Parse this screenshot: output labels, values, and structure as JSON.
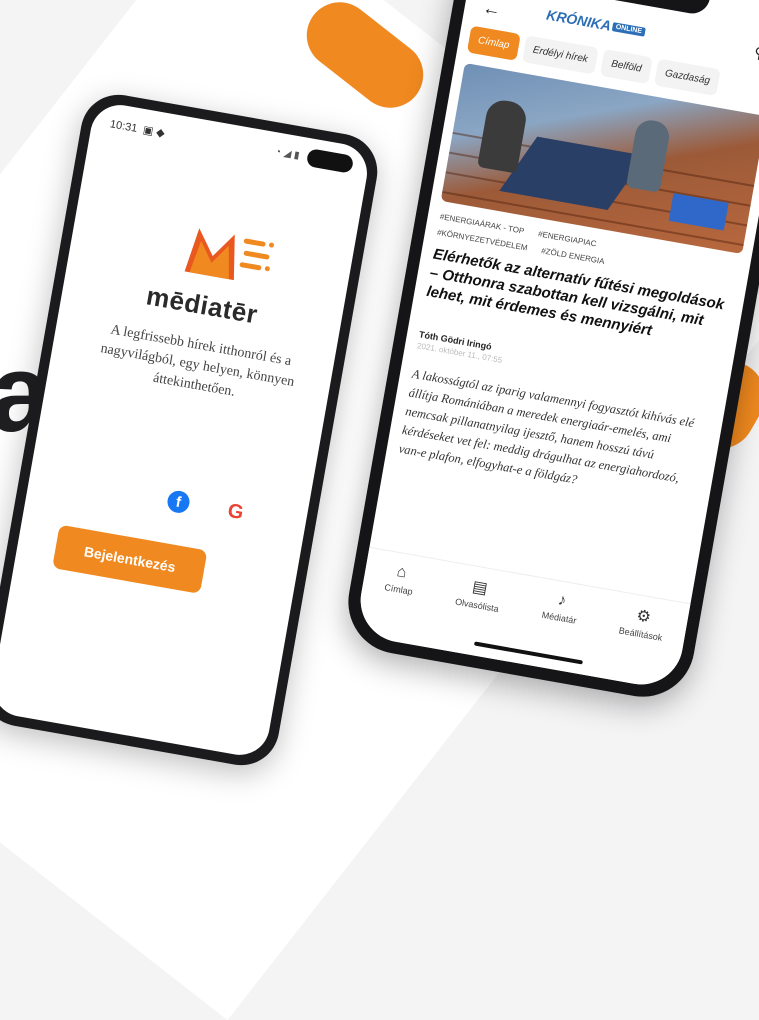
{
  "background_letter": "a",
  "android": {
    "status_time": "10:31",
    "status_icons": "▣ ◆",
    "status_right": "◔ ◢ ▮",
    "logo_text": "mēdiatēr",
    "tagline": "A legfrissebb hírek itthonról és a nagyvilágból, egy helyen, könnyen áttekinthetően.",
    "facebook_glyph": "f",
    "google_glyph": "G",
    "login_label": "Bejelentkezés"
  },
  "app": {
    "back_glyph": "←",
    "brand": "KRÓNIKA",
    "brand_badge": "ONLINE",
    "search_glyph": "⚲",
    "tabs": [
      "Címlap",
      "Erdélyi hírek",
      "Belföld",
      "Gazdaság"
    ],
    "tags": [
      "#ENERGIAÁRAK - TOP",
      "#ENERGIAPIAC",
      "#KÖRNYEZETVÉDELEM",
      "#ZÖLD ENERGIA"
    ],
    "headline": "Elérhetők az alternatív fűtési megoldások – Otthonra szabottan kell vizsgálni, mit lehet, mit érdemes és mennyiért",
    "author": "Tóth Gödri Iringó",
    "date": "2021. október 11., 07:55",
    "body": "A lakosságtól az iparig valamennyi fogyasztót kihívás elé állítja Romániában a meredek energiaár-emelés, ami nemcsak pillanatnyilag ijesztő, hanem hosszú távú kérdéseket vet fel: meddig drágulhat az energiahordozó, van-e plafon, elfogyhat-e a földgáz?",
    "nav": [
      {
        "icon": "⌂",
        "label": "Címlap"
      },
      {
        "icon": "▤",
        "label": "Olvasólista"
      },
      {
        "icon": "♪",
        "label": "Médiatár"
      },
      {
        "icon": "⚙",
        "label": "Beállítások"
      }
    ]
  },
  "colors": {
    "accent": "#f0891f",
    "brand_blue": "#2d6fb6"
  }
}
